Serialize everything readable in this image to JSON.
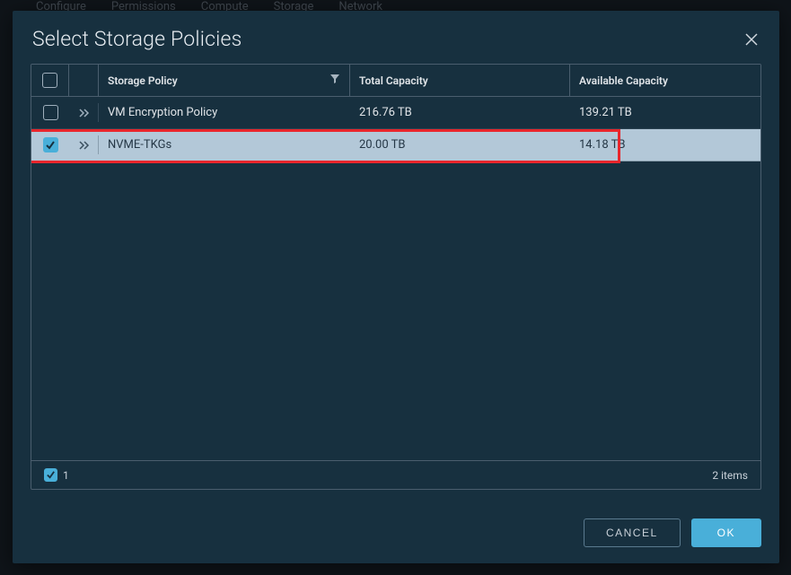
{
  "bg_menu": [
    "Configure",
    "Permissions",
    "Compute",
    "Storage",
    "Network"
  ],
  "modal": {
    "title": "Select Storage Policies",
    "columns": {
      "policy": "Storage Policy",
      "total": "Total Capacity",
      "available": "Available Capacity"
    },
    "rows": [
      {
        "checked": false,
        "selected": false,
        "policy": "VM Encryption Policy",
        "total": "216.76 TB",
        "available": "139.21 TB"
      },
      {
        "checked": true,
        "selected": true,
        "policy": "NVME-TKGs",
        "total": "20.00 TB",
        "available": "14.18 TB"
      }
    ],
    "footer": {
      "selected_count": "1",
      "items_text": "2 items"
    },
    "buttons": {
      "cancel": "CANCEL",
      "ok": "OK"
    }
  }
}
